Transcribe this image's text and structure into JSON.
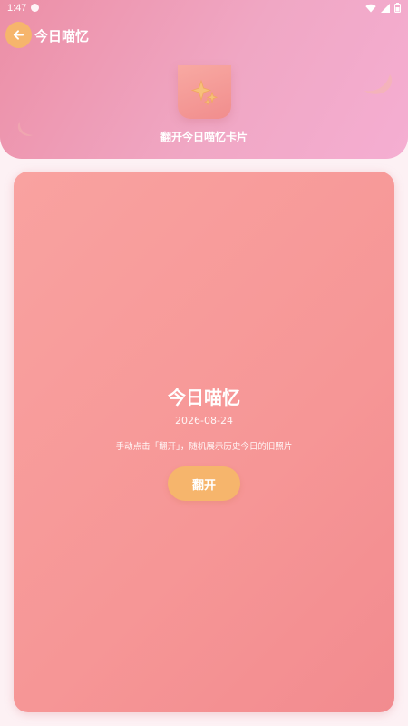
{
  "status_bar": {
    "time": "1:47"
  },
  "header": {
    "title": "今日喵忆",
    "subtitle": "翻开今日喵忆卡片",
    "back_icon": "arrow-left-icon",
    "card_icon": "sparkles-icon"
  },
  "card": {
    "title": "今日喵忆",
    "date": "2026-08-24",
    "description": "手动点击「翻开」，随机展示历史今日的旧照片",
    "button_label": "翻开"
  },
  "colors": {
    "header_gradient_start": "#ec8fa6",
    "header_gradient_end": "#f5aed2",
    "card_gradient_start": "#f9a2a0",
    "card_gradient_end": "#f28b8f",
    "accent": "#f6b56c",
    "background": "#fdf1f4"
  }
}
